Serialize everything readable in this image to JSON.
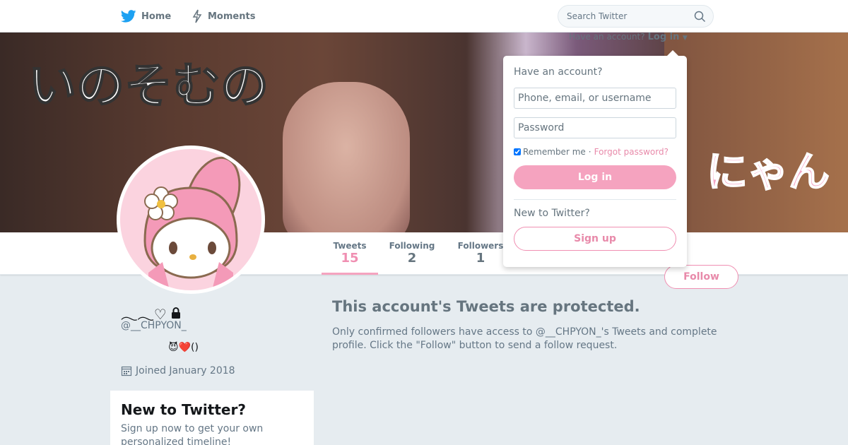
{
  "nav": {
    "home_label": "Home",
    "moments_label": "Moments",
    "search_placeholder": "Search Twitter"
  },
  "banner": {
    "have_account": "Have an account?",
    "login_label": "Log in",
    "words": [
      "いのそむの",
      "の",
      "にゃん"
    ]
  },
  "login_dropdown": {
    "title": "Have an account?",
    "username_placeholder": "Phone, email, or username",
    "password_placeholder": "Password",
    "remember_label": "Remember me",
    "separator": "·",
    "forgot_label": "Forgot password?",
    "login_button": "Log in",
    "new_label": "New to Twitter?",
    "signup_button": "Sign up"
  },
  "stats": [
    {
      "label": "Tweets",
      "value": "15",
      "active": true
    },
    {
      "label": "Following",
      "value": "2",
      "active": false
    },
    {
      "label": "Followers",
      "value": "1",
      "active": false
    }
  ],
  "follow_button": "Follow",
  "profile": {
    "name": "𓂃𓂃♡",
    "handle": "@__CHPYON_",
    "bio": "😈❤️()",
    "joined": "Joined January 2018"
  },
  "new_card": {
    "title": "New to Twitter?",
    "text": "Sign up now to get your own personalized timeline!"
  },
  "protected": {
    "title": "This account's Tweets are protected.",
    "text": "Only confirmed followers have access to @__CHPYON_'s Tweets and complete profile. Click the \"Follow\" button to send a follow request."
  },
  "colors": {
    "accent": "#f5a3bf",
    "accent_text": "#e88aaa",
    "twitter_blue": "#1da1f2"
  }
}
